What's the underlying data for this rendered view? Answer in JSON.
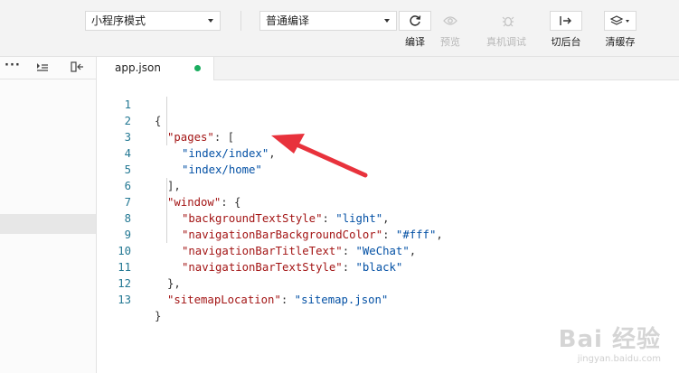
{
  "toolbar": {
    "mode_select": "小程序模式",
    "compile_select": "普通编译",
    "buttons": [
      {
        "label": "编译",
        "icon": "refresh-icon",
        "enabled": true
      },
      {
        "label": "预览",
        "icon": "eye-icon",
        "enabled": false
      },
      {
        "label": "真机调试",
        "icon": "bug-icon",
        "enabled": false
      },
      {
        "label": "切后台",
        "icon": "switch-background-icon",
        "enabled": true
      },
      {
        "label": "清缓存",
        "icon": "layers-icon",
        "enabled": true
      }
    ]
  },
  "sidebar": {
    "icons": [
      "more-icon",
      "collapse-icon",
      "split-icon"
    ]
  },
  "editor": {
    "tab": {
      "filename": "app.json",
      "modified": true
    },
    "lines": [
      {
        "num": "1",
        "text": "{"
      },
      {
        "num": "2",
        "key": "\"pages\"",
        "rest": ": ["
      },
      {
        "num": "3",
        "str": "\"index/index\"",
        "rest": ","
      },
      {
        "num": "4",
        "str": "\"index/home\"",
        "rest": ""
      },
      {
        "num": "5",
        "text": "],"
      },
      {
        "num": "6",
        "key": "\"window\"",
        "rest": ": {"
      },
      {
        "num": "7",
        "key": "\"backgroundTextStyle\"",
        "sep": ": ",
        "val": "\"light\"",
        "rest": ","
      },
      {
        "num": "8",
        "key": "\"navigationBarBackgroundColor\"",
        "sep": ": ",
        "val": "\"#fff\"",
        "rest": ","
      },
      {
        "num": "9",
        "key": "\"navigationBarTitleText\"",
        "sep": ": ",
        "val": "\"WeChat\"",
        "rest": ","
      },
      {
        "num": "10",
        "key": "\"navigationBarTextStyle\"",
        "sep": ": ",
        "val": "\"black\"",
        "rest": ""
      },
      {
        "num": "11",
        "text": "},"
      },
      {
        "num": "12",
        "key": "\"sitemapLocation\"",
        "sep": ": ",
        "val": "\"sitemap.json\"",
        "rest": ""
      },
      {
        "num": "13",
        "text": "}"
      }
    ]
  },
  "watermark": {
    "logo": "Bai 经验",
    "url": "jingyan.baidu.com"
  },
  "colors": {
    "accent_dot": "#1aad5f",
    "line_number": "#237893",
    "string": "#0451a5",
    "key": "#a31515",
    "arrow": "#e8323c"
  }
}
